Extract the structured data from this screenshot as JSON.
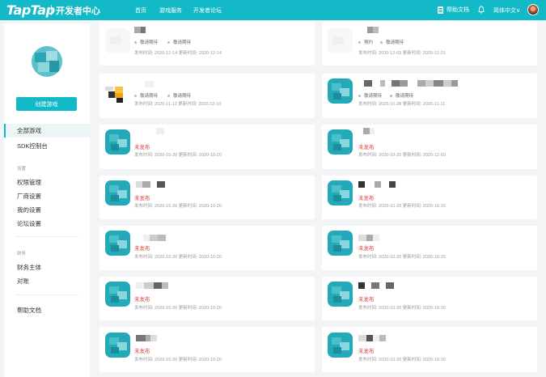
{
  "header": {
    "logo": "TapTap",
    "subtitle": "开发者中心",
    "nav": [
      "首页",
      "游戏服务",
      "开发者论坛"
    ],
    "help_doc": "帮助文档",
    "language": "简体中文∨"
  },
  "sidebar": {
    "create_button": "创建游戏",
    "items_main": [
      "全部游戏",
      "SDK控制台"
    ],
    "section_settings": "设置",
    "items_settings": [
      "权限管理",
      "厂商设置",
      "我的设置",
      "论坛设置"
    ],
    "section_finance": "财务",
    "items_finance": [
      "财务主体",
      "对账"
    ],
    "help": "帮助文档"
  },
  "cards": [
    {
      "tags": [
        "敬请期待",
        "敬请期待"
      ],
      "meta": "发布时间: 2020-12-14   更新时间: 2020-12-14"
    },
    {
      "tags": [
        "预约",
        "敬请期待"
      ],
      "meta": "发布时间: 2020-12-03   更新时间: 2020-12-21"
    },
    {
      "tags": [
        "敬请期待",
        "敬请期待"
      ],
      "meta": "发布时间: 2020-11-12   更新时间: 2020-12-10"
    },
    {
      "tags": [
        "敬请期待",
        "敬请期待"
      ],
      "meta": "发布时间: 2020-10-28   更新时间: 2020-11-11"
    },
    {
      "status": "未发布",
      "meta": "发布时间: 2020-10-20   更新时间: 2020-10-20"
    },
    {
      "status": "未发布",
      "meta": "发布时间: 2020-10-20   更新时间: 2020-12-03"
    },
    {
      "status": "未发布",
      "meta": "发布时间: 2020-10-20   更新时间: 2020-10-20"
    },
    {
      "status": "未发布",
      "meta": "发布时间: 2020-10-20   更新时间: 2020-10-20"
    },
    {
      "status": "未发布",
      "meta": "发布时间: 2020-10-20   更新时间: 2020-10-20"
    },
    {
      "status": "未发布",
      "meta": "发布时间: 2020-10-20   更新时间: 2020-10-20"
    },
    {
      "status": "未发布",
      "meta": "发布时间: 2020-10-20   更新时间: 2020-10-20"
    },
    {
      "status": "未发布",
      "meta": "发布时间: 2020-10-20   更新时间: 2020-10-20"
    },
    {
      "status": "未发布",
      "meta": "发布时间: 2020-10-20   更新时间: 2020-10-20"
    },
    {
      "status": "未发布",
      "meta": "发布时间: 2020-10-20   更新时间: 2020-10-20"
    }
  ],
  "icons": {
    "help_doc": "document-icon",
    "notifications": "bell-icon",
    "user": "avatar"
  },
  "colors": {
    "brand": "#14b9c8",
    "unpublished": "#e0403a"
  }
}
